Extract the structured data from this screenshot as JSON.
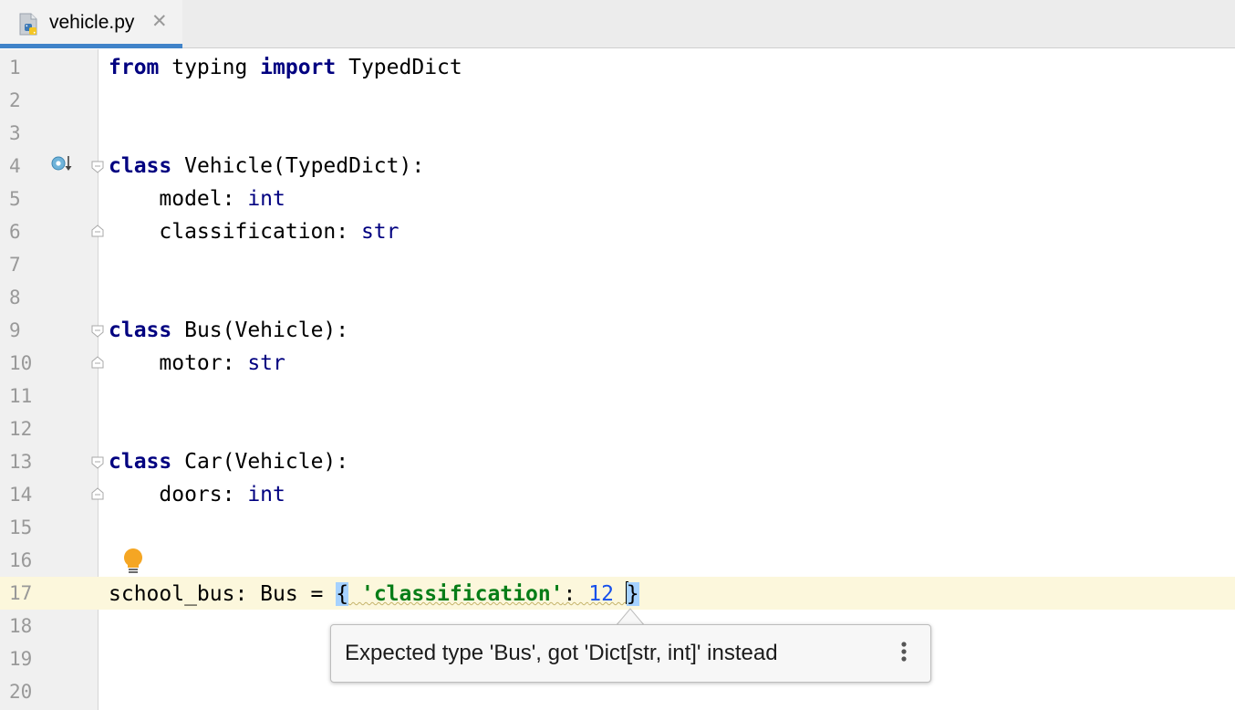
{
  "tab": {
    "title": "vehicle.py",
    "close_glyph": "✕",
    "icon": "python-file-icon"
  },
  "editor": {
    "caret_line": 17,
    "lines": [
      {
        "n": "1"
      },
      {
        "n": "2"
      },
      {
        "n": "3"
      },
      {
        "n": "4"
      },
      {
        "n": "5"
      },
      {
        "n": "6"
      },
      {
        "n": "7"
      },
      {
        "n": "8"
      },
      {
        "n": "9"
      },
      {
        "n": "10"
      },
      {
        "n": "11"
      },
      {
        "n": "12"
      },
      {
        "n": "13"
      },
      {
        "n": "14"
      },
      {
        "n": "15"
      },
      {
        "n": "16"
      },
      {
        "n": "17"
      },
      {
        "n": "18"
      },
      {
        "n": "19"
      },
      {
        "n": "20"
      }
    ],
    "code": {
      "l1": {
        "kw1": "from",
        "mod": " typing ",
        "kw2": "import",
        "name": " TypedDict"
      },
      "l4": {
        "kw": "class",
        "rest": " Vehicle(TypedDict):"
      },
      "l5": {
        "field": "    model: ",
        "type": "int"
      },
      "l6": {
        "field": "    classification: ",
        "type": "str"
      },
      "l9": {
        "kw": "class",
        "rest": " Bus(Vehicle):"
      },
      "l10": {
        "field": "    motor: ",
        "type": "str"
      },
      "l13": {
        "kw": "class",
        "rest": " Car(Vehicle):"
      },
      "l14": {
        "field": "    doors: ",
        "type": "int"
      },
      "l17": {
        "lhs": "school_bus: Bus = ",
        "open": "{",
        "key": "'classification'",
        "colon": ": ",
        "num": "12",
        "close": "}"
      }
    },
    "gutter_icons": [
      "implemented-override-icon",
      "lightbulb-icon"
    ]
  },
  "tooltip": {
    "message": "Expected type 'Bus', got 'Dict[str, int]' instead",
    "more_icon": "more-vertical-icon"
  },
  "colors": {
    "keyword": "#000080",
    "string": "#067d17",
    "number": "#1750eb",
    "caret_line": "#fcf7dc",
    "brace_match": "#a6d2ff",
    "tab_accent": "#4083c9"
  }
}
